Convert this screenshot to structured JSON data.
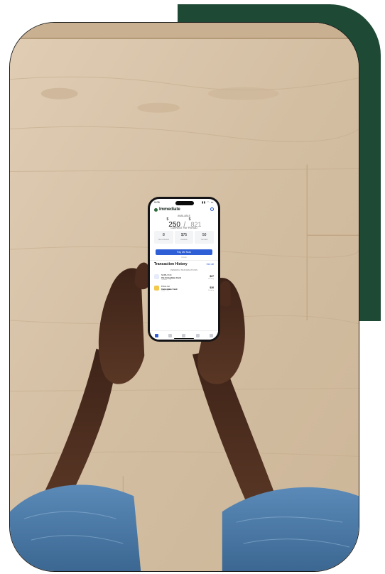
{
  "phone": {
    "status_time": "9:05",
    "status_icons": "▮▮ ◠ ▭",
    "brand": "Immediate",
    "available_label": "AVAILABLE",
    "currency": "$",
    "available_amount": "250",
    "separator": "/",
    "limit_amount": "821",
    "pay_label": "CURRENT PAY PERIOD",
    "stats": [
      {
        "value": "8",
        "label": "Hours Worked"
      },
      {
        "value": "$75",
        "label": "Available"
      },
      {
        "value": "50",
        "label": "Transfers"
      }
    ],
    "pay_button_label": "Pay Me Now",
    "small_link": "Details",
    "transactions_title": "Transaction History",
    "see_all_label": "See All",
    "pending_label": "PENDING TRANSACTIONS",
    "transactions": [
      {
        "name": "NOBU INC",
        "sub": "Via Immediate Card",
        "meta": "Transfer ····17",
        "amount": "$27",
        "status": "Pending"
      },
      {
        "name": "Pizza Inc",
        "sub": "Immediate Card",
        "meta": "Card ····17",
        "amount": "$26",
        "status": "Pending"
      }
    ]
  },
  "colors": {
    "accent_green": "#1e4a35",
    "app_blue": "#2f5fd6",
    "wood": "#d6c2a8",
    "denim": "#4a7baa",
    "skin": "#4e2f1f"
  }
}
